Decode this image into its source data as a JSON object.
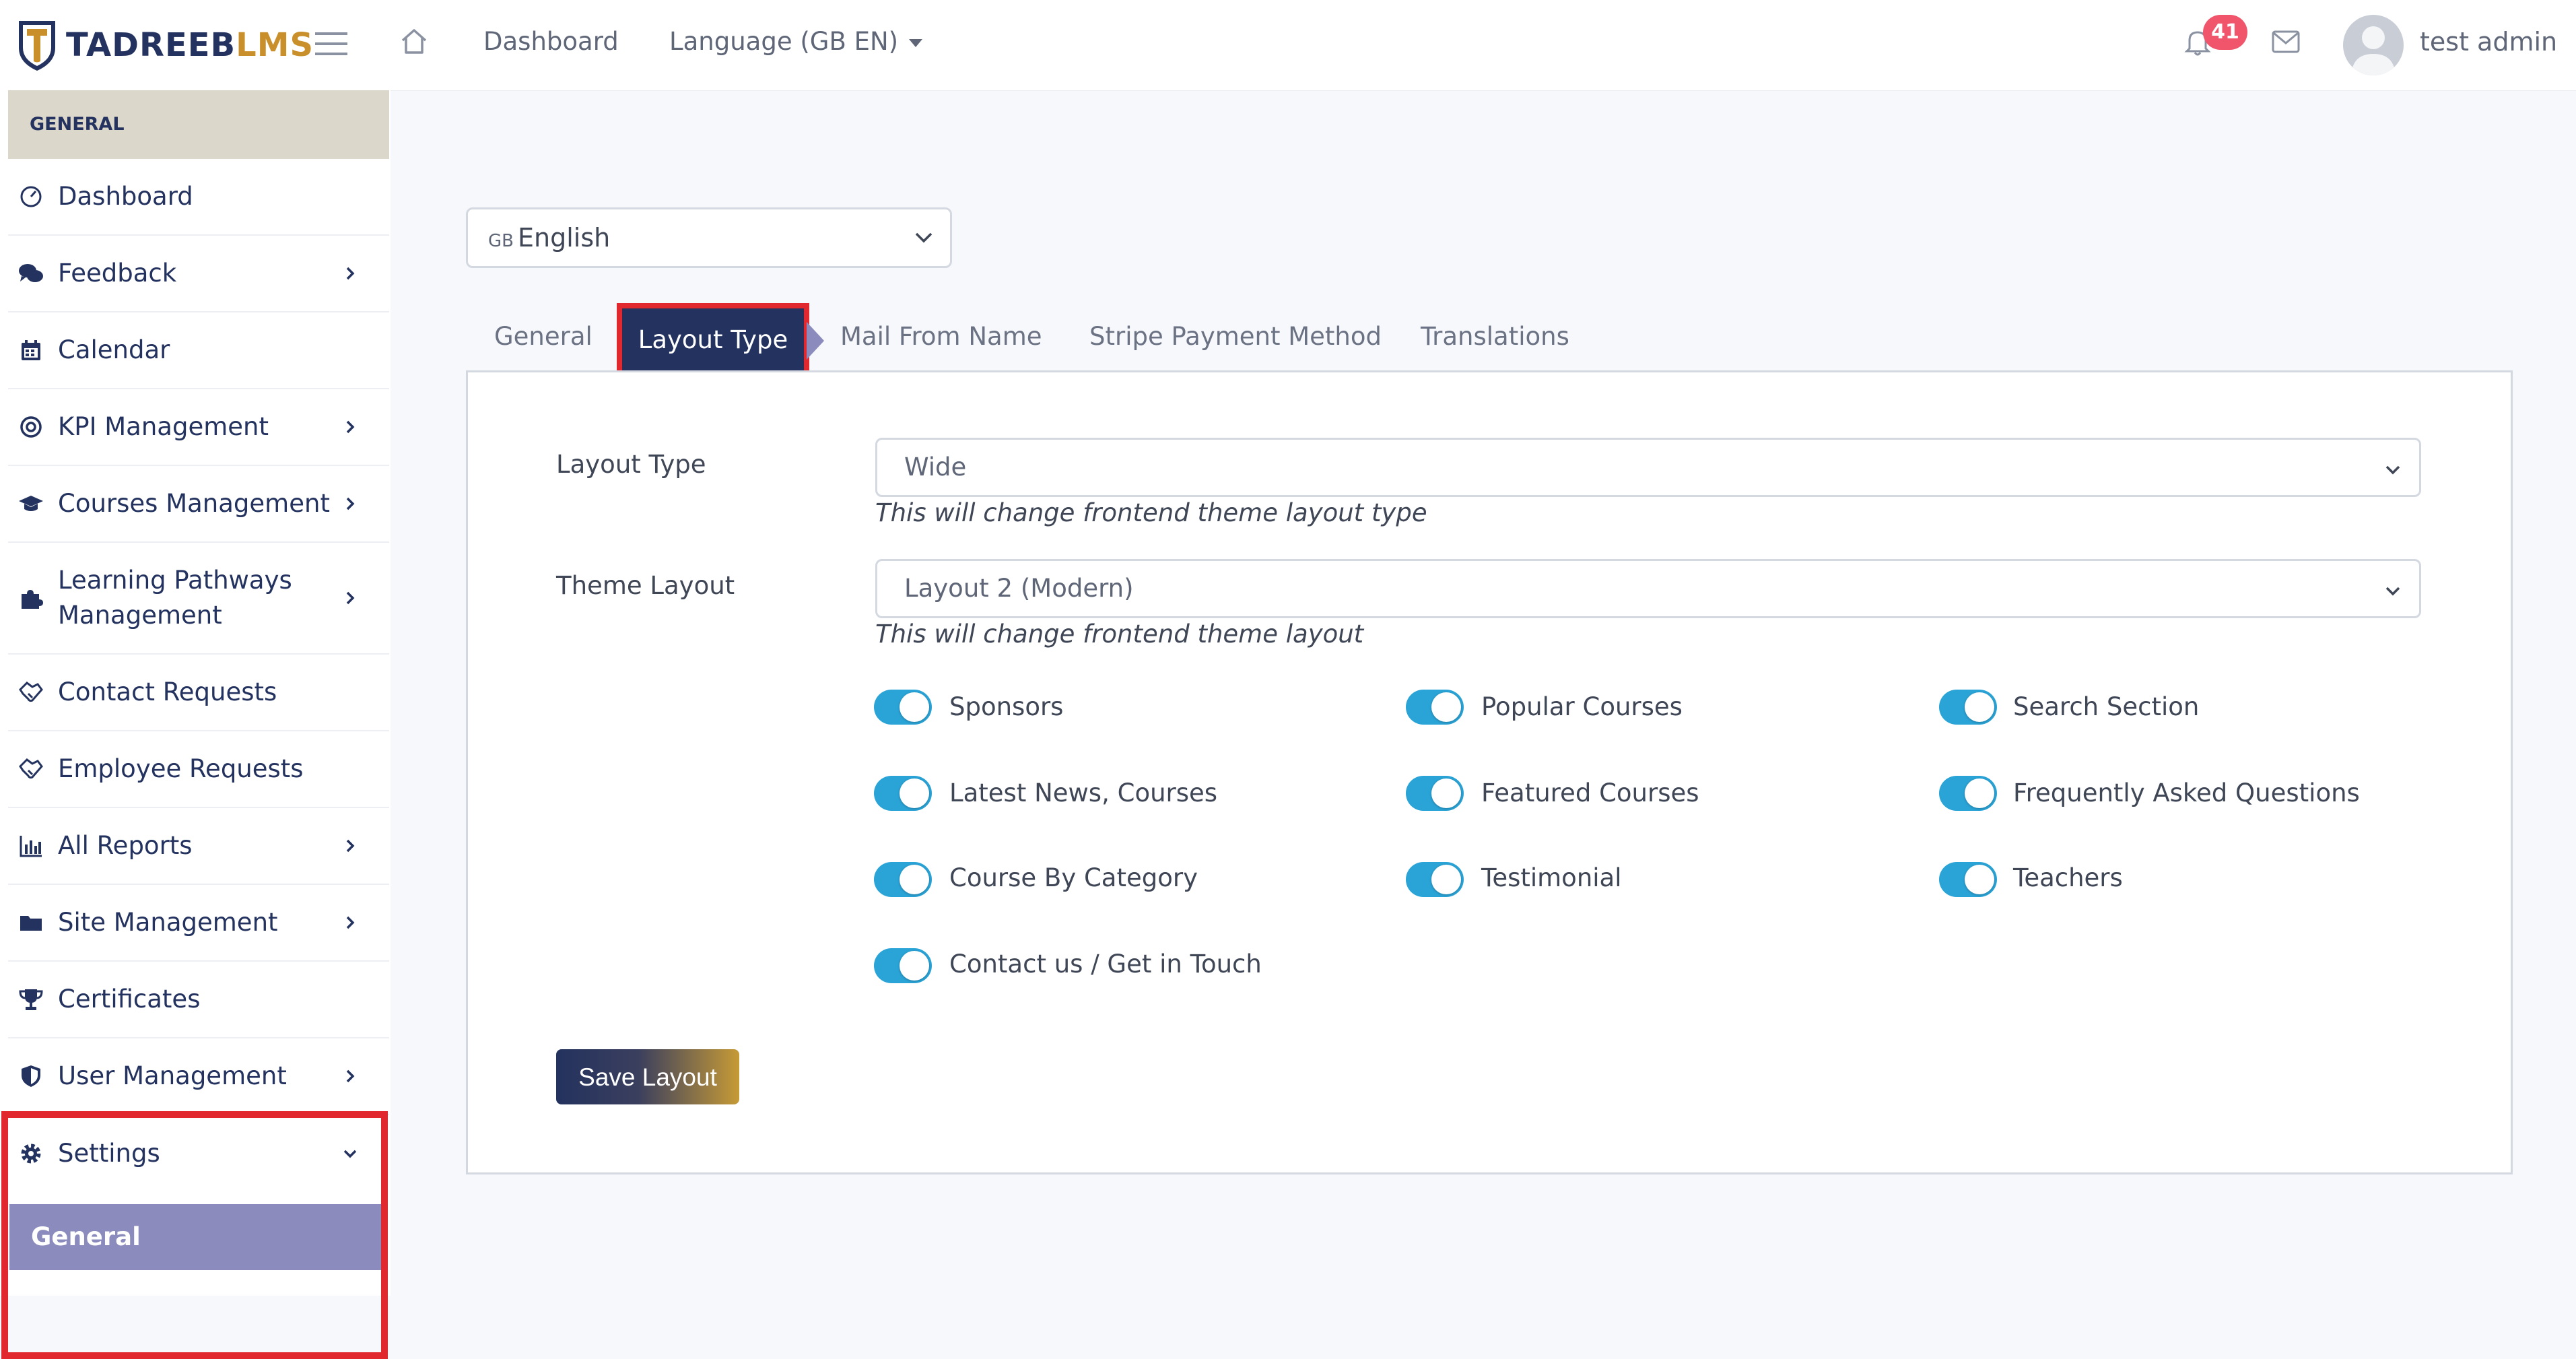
{
  "header": {
    "brand_part1": "TADREEB",
    "brand_part2": "LMS",
    "nav_dashboard": "Dashboard",
    "nav_language": "Language (GB EN)",
    "notification_count": "41",
    "user_name": "test admin",
    "icons": [
      "menu-icon",
      "home-icon",
      "bell-icon",
      "mail-icon",
      "avatar"
    ]
  },
  "sidebar": {
    "section_title": "GENERAL",
    "items": [
      {
        "label": "Dashboard",
        "icon": "gauge-icon",
        "has_children": false
      },
      {
        "label": "Feedback",
        "icon": "comments-icon",
        "has_children": true
      },
      {
        "label": "Calendar",
        "icon": "calendar-icon",
        "has_children": false
      },
      {
        "label": "KPI Management",
        "icon": "target-icon",
        "has_children": true
      },
      {
        "label": "Courses Management",
        "icon": "graduation-cap-icon",
        "has_children": true
      },
      {
        "label": "Learning Pathways Management",
        "icon": "puzzle-icon",
        "has_children": true
      },
      {
        "label": "Contact Requests",
        "icon": "handshake-icon",
        "has_children": false
      },
      {
        "label": "Employee Requests",
        "icon": "handshake-icon",
        "has_children": false
      },
      {
        "label": "All Reports",
        "icon": "bar-chart-icon",
        "has_children": true
      },
      {
        "label": "Site Management",
        "icon": "folder-icon",
        "has_children": true
      },
      {
        "label": "Certificates",
        "icon": "trophy-icon",
        "has_children": false
      },
      {
        "label": "User Management",
        "icon": "shield-icon",
        "has_children": true
      },
      {
        "label": "Settings",
        "icon": "gear-icon",
        "has_children": true,
        "expanded": true
      }
    ],
    "settings_sub": "General"
  },
  "main": {
    "language_select": {
      "flag": "GB",
      "value": "English"
    },
    "tabs": [
      {
        "label": "General",
        "active": false
      },
      {
        "label": "Layout Type",
        "active": true
      },
      {
        "label": "Mail From Name",
        "active": false
      },
      {
        "label": "Stripe Payment Method",
        "active": false
      },
      {
        "label": "Translations",
        "active": false
      }
    ],
    "layout_type": {
      "label": "Layout Type",
      "value": "Wide",
      "hint": "This will change frontend theme layout type"
    },
    "theme_layout": {
      "label": "Theme Layout",
      "value": "Layout 2 (Modern)",
      "hint": "This will change frontend theme layout"
    },
    "toggles": [
      {
        "label": "Sponsors",
        "on": true
      },
      {
        "label": "Popular Courses",
        "on": true
      },
      {
        "label": "Search Section",
        "on": true
      },
      {
        "label": "Latest News, Courses",
        "on": true
      },
      {
        "label": "Featured Courses",
        "on": true
      },
      {
        "label": "Frequently Asked Questions",
        "on": true
      },
      {
        "label": "Course By Category",
        "on": true
      },
      {
        "label": "Testimonial",
        "on": true
      },
      {
        "label": "Teachers",
        "on": true
      },
      {
        "label": "Contact us / Get in Touch",
        "on": true
      }
    ],
    "save_label": "Save Layout"
  },
  "colors": {
    "brand_navy": "#23325e",
    "brand_gold": "#c98f2a",
    "toggle_on": "#2aa3d6",
    "highlight_red": "#e0282e",
    "submenu_active": "#8b8bbd",
    "badge": "#f1556c"
  }
}
